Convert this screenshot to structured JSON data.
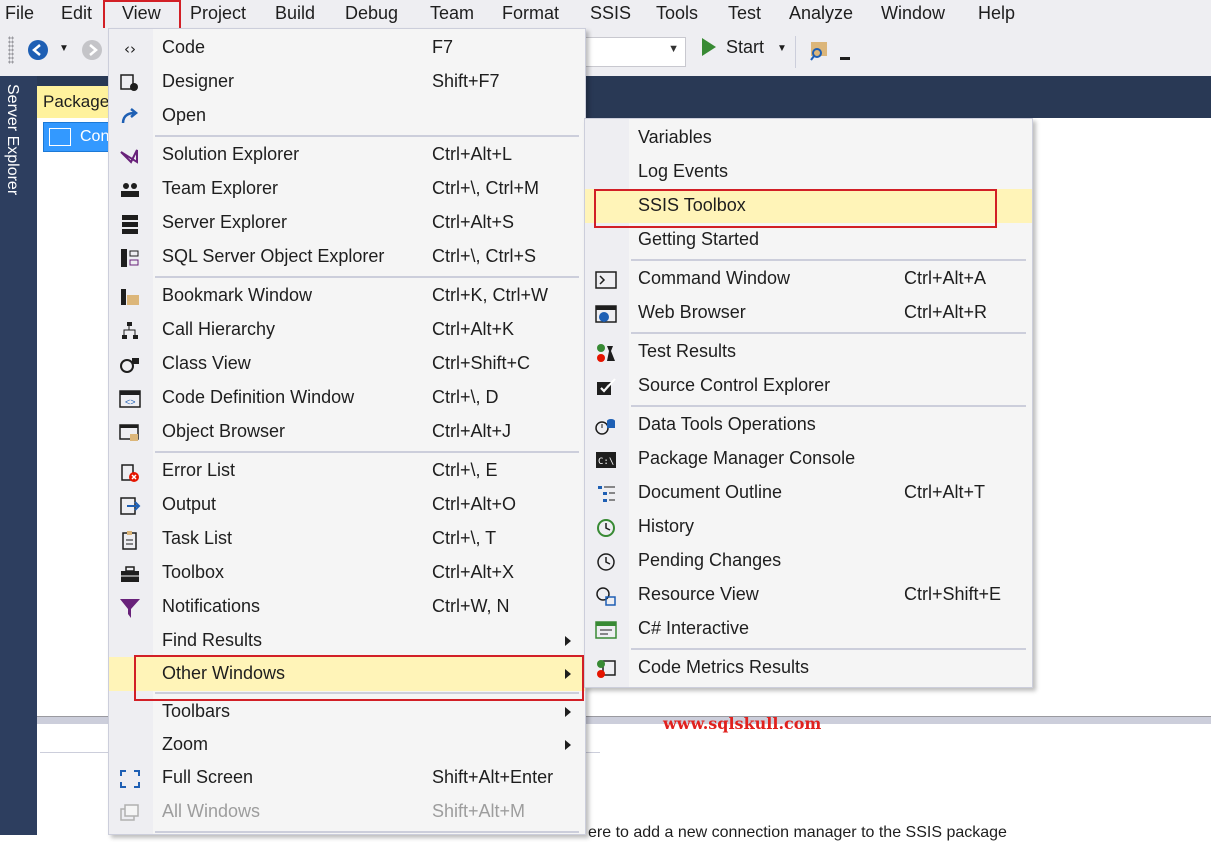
{
  "menubar": {
    "items": [
      "File",
      "Edit",
      "View",
      "Project",
      "Build",
      "Debug",
      "Team",
      "Format",
      "SSIS",
      "Tools",
      "Test",
      "Analyze",
      "Window",
      "Help"
    ]
  },
  "toolbar": {
    "start_label": "Start"
  },
  "side": {
    "server_explorer": "Server Explorer"
  },
  "document": {
    "tab_label": "Package",
    "control_flow_label": "Con"
  },
  "view_menu": {
    "items": [
      {
        "label": "Code",
        "shortcut": "F7",
        "icon": "code-icon"
      },
      {
        "label": "Designer",
        "shortcut": "Shift+F7",
        "icon": "designer-icon"
      },
      {
        "label": "Open",
        "shortcut": "",
        "icon": "open-icon"
      },
      {
        "label": "Solution Explorer",
        "shortcut": "Ctrl+Alt+L",
        "icon": "solution-explorer-icon"
      },
      {
        "label": "Team Explorer",
        "shortcut": "Ctrl+\\, Ctrl+M",
        "icon": "team-explorer-icon"
      },
      {
        "label": "Server Explorer",
        "shortcut": "Ctrl+Alt+S",
        "icon": "server-explorer-icon"
      },
      {
        "label": "SQL Server Object Explorer",
        "shortcut": "Ctrl+\\, Ctrl+S",
        "icon": "sql-object-explorer-icon"
      },
      {
        "label": "Bookmark Window",
        "shortcut": "Ctrl+K, Ctrl+W",
        "icon": "bookmark-icon"
      },
      {
        "label": "Call Hierarchy",
        "shortcut": "Ctrl+Alt+K",
        "icon": "call-hierarchy-icon"
      },
      {
        "label": "Class View",
        "shortcut": "Ctrl+Shift+C",
        "icon": "class-view-icon"
      },
      {
        "label": "Code Definition Window",
        "shortcut": "Ctrl+\\, D",
        "icon": "code-definition-icon"
      },
      {
        "label": "Object Browser",
        "shortcut": "Ctrl+Alt+J",
        "icon": "object-browser-icon"
      },
      {
        "label": "Error List",
        "shortcut": "Ctrl+\\, E",
        "icon": "error-list-icon"
      },
      {
        "label": "Output",
        "shortcut": "Ctrl+Alt+O",
        "icon": "output-icon"
      },
      {
        "label": "Task List",
        "shortcut": "Ctrl+\\, T",
        "icon": "task-list-icon"
      },
      {
        "label": "Toolbox",
        "shortcut": "Ctrl+Alt+X",
        "icon": "toolbox-icon"
      },
      {
        "label": "Notifications",
        "shortcut": "Ctrl+W, N",
        "icon": "notifications-icon"
      },
      {
        "label": "Find Results",
        "shortcut": "",
        "icon": ""
      },
      {
        "label": "Other Windows",
        "shortcut": "",
        "icon": ""
      },
      {
        "label": "Toolbars",
        "shortcut": "",
        "icon": ""
      },
      {
        "label": "Zoom",
        "shortcut": "",
        "icon": ""
      },
      {
        "label": "Full Screen",
        "shortcut": "Shift+Alt+Enter",
        "icon": "full-screen-icon"
      },
      {
        "label": "All Windows",
        "shortcut": "Shift+Alt+M",
        "icon": "all-windows-icon"
      }
    ]
  },
  "other_windows_menu": {
    "items": [
      {
        "label": "Variables",
        "shortcut": "",
        "icon": ""
      },
      {
        "label": "Log Events",
        "shortcut": "",
        "icon": ""
      },
      {
        "label": "SSIS Toolbox",
        "shortcut": "",
        "icon": ""
      },
      {
        "label": "Getting Started",
        "shortcut": "",
        "icon": ""
      },
      {
        "label": "Command Window",
        "shortcut": "Ctrl+Alt+A",
        "icon": "command-window-icon"
      },
      {
        "label": "Web Browser",
        "shortcut": "Ctrl+Alt+R",
        "icon": "web-browser-icon"
      },
      {
        "label": "Test Results",
        "shortcut": "",
        "icon": "test-results-icon"
      },
      {
        "label": "Source Control Explorer",
        "shortcut": "",
        "icon": "source-control-icon"
      },
      {
        "label": "Data Tools Operations",
        "shortcut": "",
        "icon": "data-tools-icon"
      },
      {
        "label": "Package Manager Console",
        "shortcut": "",
        "icon": "package-manager-icon"
      },
      {
        "label": "Document Outline",
        "shortcut": "Ctrl+Alt+T",
        "icon": "document-outline-icon"
      },
      {
        "label": "History",
        "shortcut": "",
        "icon": "history-icon"
      },
      {
        "label": "Pending Changes",
        "shortcut": "",
        "icon": "pending-changes-icon"
      },
      {
        "label": "Resource View",
        "shortcut": "Ctrl+Shift+E",
        "icon": "resource-view-icon"
      },
      {
        "label": "C# Interactive",
        "shortcut": "",
        "icon": "csharp-interactive-icon"
      },
      {
        "label": "Code Metrics Results",
        "shortcut": "",
        "icon": "code-metrics-icon"
      }
    ]
  },
  "watermark": "www.sqlskull.com",
  "bottom_text": "ere to add a new connection manager to the SSIS package",
  "colors": {
    "highlight": "#fff4b8",
    "annotation_red": "#d21f26",
    "frame_dark": "#293955",
    "selected_blue": "#3399ff"
  }
}
